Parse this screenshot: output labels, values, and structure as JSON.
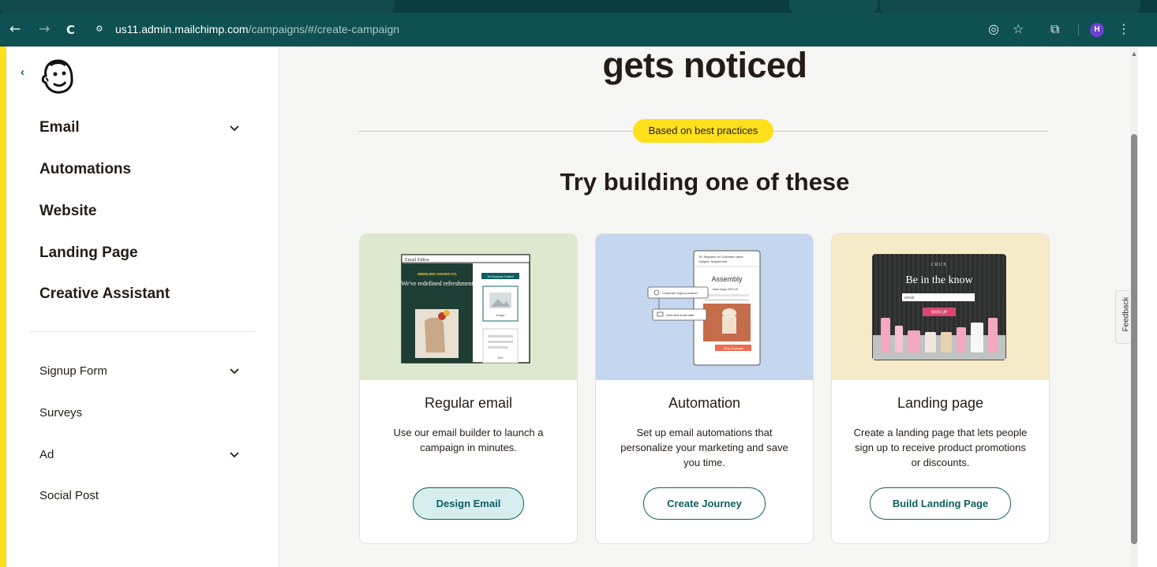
{
  "browser": {
    "nav_back": "←",
    "nav_forward": "→",
    "reload": "C",
    "url_host": "us11.admin.mailchimp.com",
    "url_path": "/campaigns/#/create-campaign",
    "profile_initial": "H"
  },
  "sidebar": {
    "back_glyph": "‹",
    "primary_items": [
      {
        "label": "Email"
      },
      {
        "label": "Automations"
      },
      {
        "label": "Website"
      },
      {
        "label": "Landing Page"
      },
      {
        "label": "Creative Assistant"
      }
    ],
    "secondary_items": [
      {
        "label": "Signup Form"
      },
      {
        "label": "Surveys"
      },
      {
        "label": "Ad"
      },
      {
        "label": "Social Post"
      }
    ]
  },
  "main": {
    "hero_title": "gets noticed",
    "badge": "Based on best practices",
    "section_title": "Try building one of these",
    "cards": [
      {
        "title": "Regular email",
        "description": "Use our email builder to launch a campaign in minutes.",
        "button": "Design Email",
        "art": {
          "editor_label": "Email Editor",
          "brand": "SEEDLING GOODS CO.",
          "headline": "We've redefined refreshment",
          "chip": "Set Dynamic Content",
          "image_label": "Image",
          "text_label": "Text"
        }
      },
      {
        "title": "Automation",
        "description": "Set up email automations that personalize your marketing and save you time.",
        "button": "Create Journey",
        "art": {
          "meta_1": "To: Segment or Customer name",
          "meta_2": "Subject: Subject line",
          "heading": "Assembly",
          "promo": "Now enjoy 20% off",
          "step_1": "Customer buys a product",
          "step_2": "Gets first email offer",
          "cta": "Shop Anyways"
        }
      },
      {
        "title": "Landing page",
        "description": "Create a landing page that lets people sign up to receive product promotions or discounts.",
        "button": "Build Landing Page",
        "art": {
          "brand": "CRUX",
          "headline": "Be in the know",
          "field": "email",
          "cta": "SIGN UP"
        }
      }
    ]
  },
  "feedback_tab": "Feedback",
  "colors": {
    "brand_teal": "#0f5052",
    "accent_yellow": "#ffe01b",
    "button_teal": "#0f5f62"
  }
}
